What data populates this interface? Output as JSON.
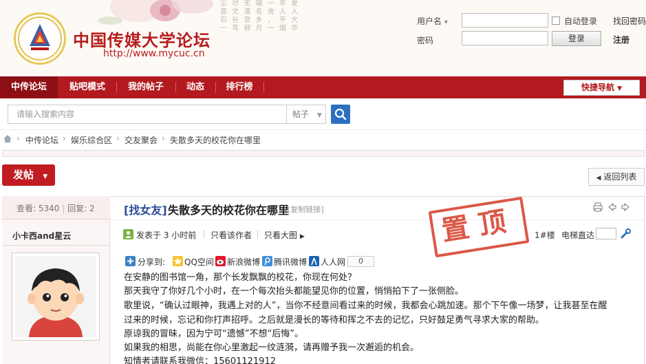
{
  "header": {
    "calligraphy": [
      "尘 尽 无 端 一 年 夏",
      "音 文 清 名 舍 人 人",
      "石 谷 音 乡 ， 平 大",
      "一 弯 柳 月 一 烟 华"
    ],
    "site_title": "中国传媒大学论坛",
    "site_url": "http://www.mycuc.cn",
    "username_label": "用户名",
    "password_label": "密码",
    "auto_login_label": "自动登录",
    "forgot_password": "找回密码",
    "login_button": "登录",
    "register_link": "注册"
  },
  "nav": {
    "items": [
      "中传论坛",
      "贴吧模式",
      "我的帖子",
      "动态",
      "排行榜"
    ],
    "quick_nav": "快捷导航"
  },
  "search": {
    "placeholder": "请输入搜索内容",
    "type": "帖子"
  },
  "breadcrumb": [
    "中传论坛",
    "娱乐综合区",
    "交友聚会",
    "失散多天的校花你在哪里"
  ],
  "actions": {
    "post_button": "发帖",
    "back_button": "返回列表"
  },
  "thread": {
    "views_label": "查看:",
    "views": "5340",
    "replies_label": "回复:",
    "replies": "2",
    "tag": "[找女友]",
    "title": "失散多天的校花你在哪里",
    "copy_link": "[复制链接]",
    "author": "小卡西and星云",
    "posted": "发表于 3 小时前",
    "only_author": "只看该作者",
    "big_image": "只看大图",
    "floor": "1#楼",
    "floor_jump": "电梯直达",
    "stamp": "置顶",
    "share": {
      "label": "分享到:",
      "qq_space": "QQ空间",
      "sina": "新浪微博",
      "tencent": "腾讯微博",
      "renren": "人人网",
      "count": "0"
    },
    "body": [
      "在安静的图书馆一角，那个长发飘飘的校花，你现在何处？",
      "那天我守了你好几个小时，在一个每次抬头都能望见你的位置，悄悄拍下了一张侧脸。",
      "歌里说，“确认过眼神，我遇上对的人”，当你不经意间看过来的时候，我都会心跳加速。那个下午像一场梦，让我甚至在醒",
      "过来的时候，忘记和你打声招呼。之后就是漫长的等待和挥之不去的记忆，只好鼓足勇气寻求大家的帮助。",
      "原谅我的冒昧，因为宁可“遗憾”不想“后悔”。",
      "如果我的相思，尚能在你心里激起一纹涟漪，请再赠予我一次邂逅的机会。",
      "知情者请联系我微信：15601121912"
    ]
  },
  "colors": {
    "brand_red": "#b31a1f",
    "nav_active": "#8e0f13",
    "tag_blue": "#2d4b99",
    "stamp_red": "#d84a3a"
  }
}
